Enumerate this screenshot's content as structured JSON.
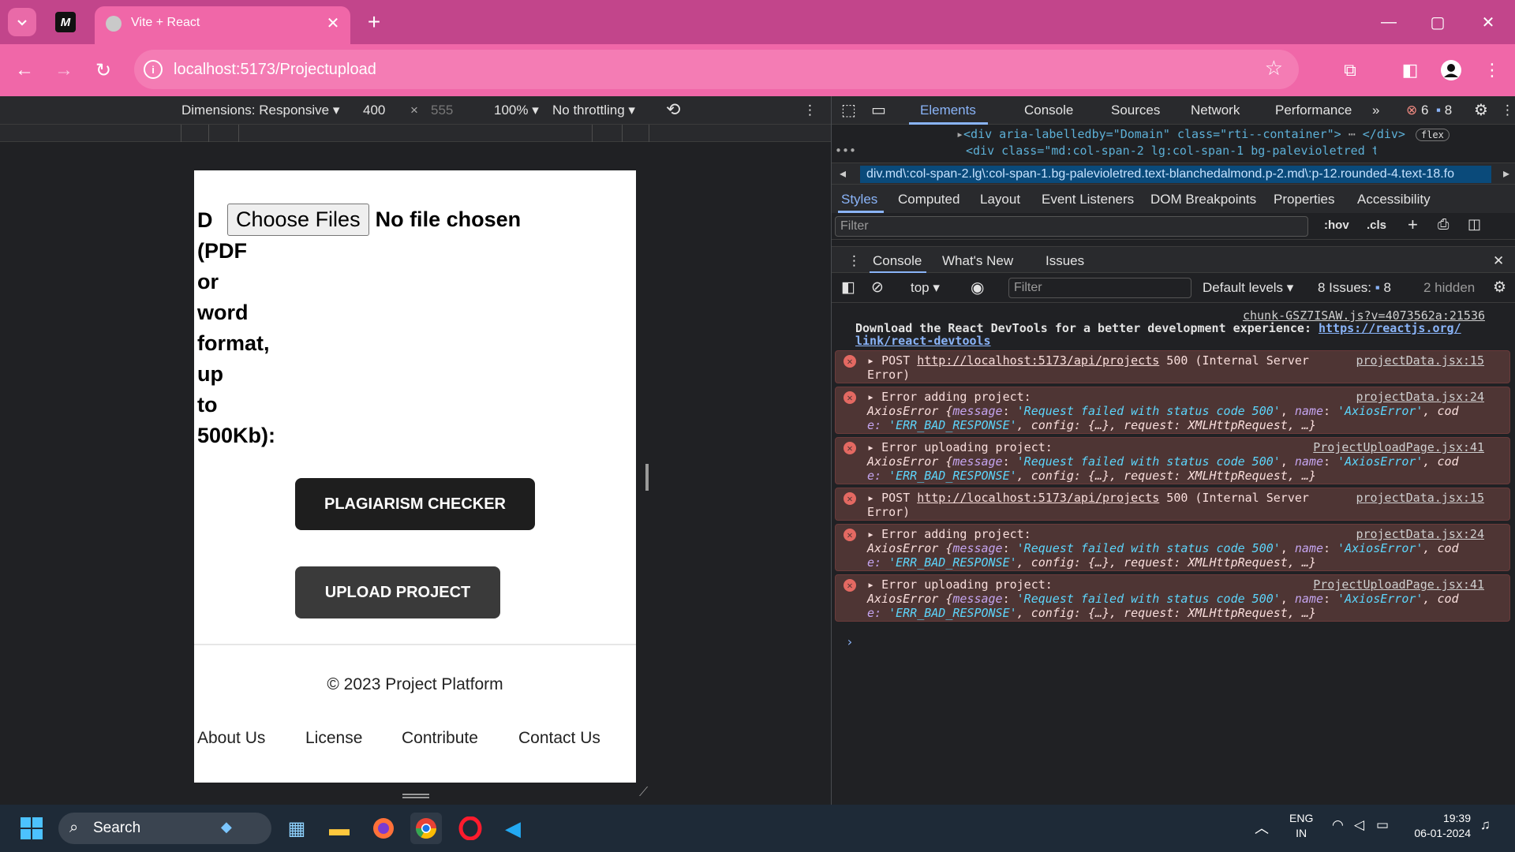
{
  "browser": {
    "tab_title": "Vite + React",
    "pinned_label": "M",
    "url": "localhost:5173/Projectupload"
  },
  "device_toolbar": {
    "dimensions": "Dimensions: Responsive",
    "width": "400",
    "times": "×",
    "height": "555",
    "zoom": "100%",
    "throttling": "No throttling"
  },
  "page": {
    "upload_label_lines": [
      "D",
      "(PDF",
      "or",
      "word",
      "format,",
      "up",
      "to",
      "500Kb):"
    ],
    "choose_files": "Choose Files",
    "no_file": "No file chosen",
    "plagiarism_button": "PLAGIARISM CHECKER",
    "upload_button": "UPLOAD PROJECT",
    "copyright": "© 2023 Project Platform",
    "footer_links": [
      "About Us",
      "License",
      "Contribute",
      "Contact Us"
    ]
  },
  "devtools": {
    "tabs": [
      "Elements",
      "Console",
      "Sources",
      "Network",
      "Performance"
    ],
    "error_count": "6",
    "message_count": "8",
    "dom_line1_tag": "<div aria-labelledby=\"Domain\" class=\"rti--container\">",
    "dom_line1_end": "</div>",
    "dom_flex_badge": "flex",
    "dom_line2": "<div class=\"md:col-span-2 lg:col-span-1 bg-palevioletred text-blanchedal",
    "breadcrumb": "div.md\\:col-span-2.lg\\:col-span-1.bg-palevioletred.text-blanchedalmond.p-2.md\\:p-12.rounded-4.text-18.fo",
    "style_tabs": [
      "Styles",
      "Computed",
      "Layout",
      "Event Listeners",
      "DOM Breakpoints",
      "Properties",
      "Accessibility"
    ],
    "filter_placeholder": "Filter",
    "hov": ":hov",
    "cls": ".cls",
    "drawer_tabs": [
      "Console",
      "What's New",
      "Issues"
    ],
    "console_context": "top",
    "console_filter": "Filter",
    "default_levels": "Default levels",
    "issues": "8 Issues:",
    "issues_count": "8",
    "hidden": "2 hidden"
  },
  "console": {
    "msg0_src": "chunk-GSZ7ISAW.js?v=4073562a:21536",
    "msg0_text": "Download the React DevTools for a better development experience: ",
    "msg0_link1": "https://reactjs.org/",
    "msg0_link2": "link/react-devtools",
    "post_prefix": "POST ",
    "post_url": "http://localhost:5173/api/projects",
    "post_status": " 500 (Internal Server",
    "post_error": "Error)",
    "post_src": "projectData.jsx:15",
    "adding": "Error adding project:",
    "adding_src": "projectData.jsx:24",
    "uploading": "Error uploading project:",
    "uploading_src": "ProjectUploadPage.jsx:41",
    "axios_line1_pre": "AxiosError {",
    "axios_line1_key1": "message",
    "axios_line1_val1": "'Request failed with status code 500'",
    "axios_line1_key2": "name",
    "axios_line1_val2": "'AxiosError'",
    "axios_line1_tail": ", cod",
    "axios_line2_head": "e: ",
    "axios_line2_val": "'ERR_BAD_RESPONSE'",
    "axios_line2_rest": ", config: {…}, request: XMLHttpRequest, …}"
  },
  "taskbar": {
    "search": "Search",
    "lang1": "ENG",
    "lang2": "IN",
    "time": "19:39",
    "date": "06-01-2024"
  },
  "colors": {
    "tab_strip": "#c2458b",
    "toolbar": "#f067a8",
    "button_dark": "#1e1e1e",
    "button_mid": "#3a3a3a",
    "devtools_accent": "#8ab4f8",
    "error_bg": "#4e3534"
  }
}
